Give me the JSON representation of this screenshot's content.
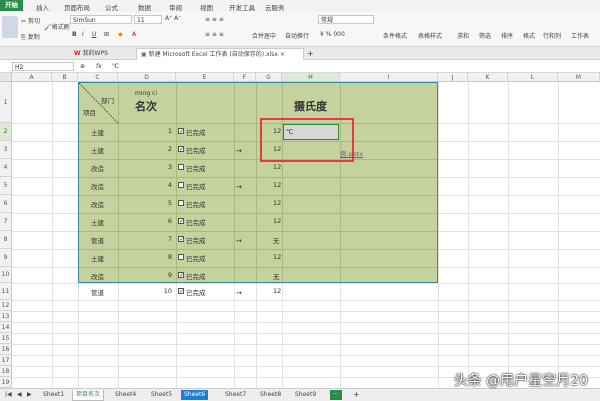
{
  "menu": {
    "items": [
      "开始",
      "插入",
      "页面布局",
      "公式",
      "数据",
      "审阅",
      "视图",
      "开发工具",
      "云服务"
    ]
  },
  "ribbon": {
    "cut_label": "剪切",
    "copy_label": "复制",
    "format_painter_label": "格式刷",
    "font_name": "SimSun",
    "font_size": "11",
    "merge_center_label": "合并居中",
    "wrap_label": "自动换行",
    "number_format": "常规",
    "cond_format_label": "条件格式",
    "table_style_label": "表格样式",
    "sum_label": "求和",
    "filter_label": "筛选",
    "sort_label": "排序",
    "format_label": "格式",
    "rowcol_label": "行和列",
    "worksheet_label": "工作表"
  },
  "tabs": {
    "wps_label": "我的WPS",
    "doc_label": "新建 Microsoft Excel 工作表 (自动保存的).xlsx",
    "add_label": "+"
  },
  "formula_bar": {
    "cell_ref": "H2",
    "content": "℃"
  },
  "columns": [
    "A",
    "B",
    "C",
    "D",
    "E",
    "F",
    "G",
    "H",
    "I",
    "J",
    "K",
    "L",
    "M"
  ],
  "rows": [
    "1",
    "2",
    "3",
    "4",
    "5",
    "6",
    "7",
    "8",
    "9",
    "10",
    "11",
    "12",
    "13",
    "14",
    "15",
    "16",
    "17",
    "18",
    "19"
  ],
  "table": {
    "header_dept": "部门",
    "header_item": "项目",
    "header_pinyin": "ming ci",
    "header_rank": "名次",
    "header_celsius": "摄氏度",
    "rows": [
      {
        "dept": "土建",
        "rank": "1",
        "checked": true,
        "status": "已完成",
        "arrow": "",
        "g": "12",
        "h": "℃"
      },
      {
        "dept": "土建",
        "rank": "2",
        "checked": true,
        "status": "已完成",
        "arrow": "→",
        "g": "12",
        "h": ""
      },
      {
        "dept": "改造",
        "rank": "3",
        "checked": false,
        "status": "已完成",
        "arrow": "",
        "g": "12",
        "h": ""
      },
      {
        "dept": "改造",
        "rank": "4",
        "checked": false,
        "status": "已完成",
        "arrow": "→",
        "g": "12",
        "h": ""
      },
      {
        "dept": "改造",
        "rank": "5",
        "checked": false,
        "status": "已完成",
        "arrow": "",
        "g": "12",
        "h": ""
      },
      {
        "dept": "土建",
        "rank": "6",
        "checked": true,
        "status": "已完成",
        "arrow": "",
        "g": "12",
        "h": ""
      },
      {
        "dept": "管道",
        "rank": "7",
        "checked": true,
        "status": "已完成",
        "arrow": "→",
        "g": "无",
        "h": ""
      },
      {
        "dept": "土建",
        "rank": "8",
        "checked": false,
        "status": "已完成",
        "arrow": "",
        "g": "12",
        "h": ""
      },
      {
        "dept": "改造",
        "rank": "9",
        "checked": true,
        "status": "已完成",
        "arrow": "",
        "g": "无",
        "h": ""
      },
      {
        "dept": "管道",
        "rank": "10",
        "checked": true,
        "status": "已完成",
        "arrow": "→",
        "g": "12",
        "h": ""
      }
    ],
    "hyperlink_text": "例.potx"
  },
  "sheets": [
    "Sheet1",
    "项目名次",
    "Sheet4",
    "Sheet5",
    "Sheet6",
    "Sheet7",
    "Sheet8",
    "Sheet9"
  ],
  "active_sheet": "Sheet6",
  "watermark": "头条 @用户星空月20",
  "colors": {
    "accent": "#2b8c4a",
    "table_fill": "#c5d29e",
    "highlight": "#e23b3b",
    "sheet_active": "#1e7fd0"
  }
}
